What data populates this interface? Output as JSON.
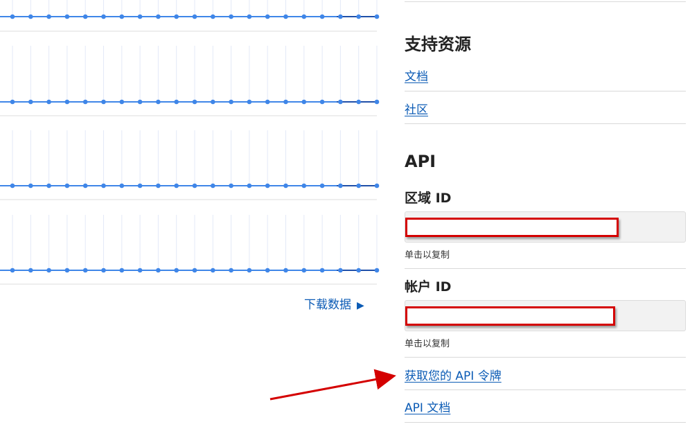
{
  "charts": {
    "rows": 4,
    "points_per_row": 21,
    "line_color": "#3f86e8",
    "grid_color": "#e3e9f7",
    "download_label": "下载数据"
  },
  "support": {
    "title": "支持资源",
    "docs_label": "文档",
    "community_label": "社区"
  },
  "api": {
    "title": "API",
    "region_id_label": "区域 ID",
    "region_copy_hint": "单击以复制",
    "account_id_label": "帐户 ID",
    "account_copy_hint": "单击以复制",
    "get_token_label": "获取您的 API 令牌",
    "api_docs_label": "API 文档"
  },
  "colors": {
    "link": "#0b5bb5",
    "annotation_red": "#d40000"
  }
}
